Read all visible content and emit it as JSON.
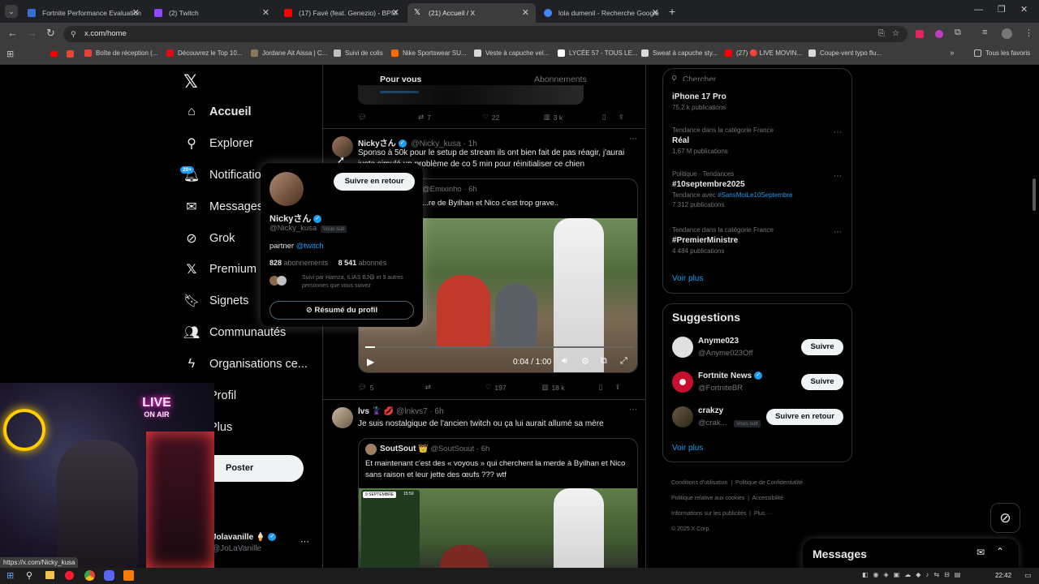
{
  "browser": {
    "tabs": [
      {
        "title": "Fortnite Performance Evaluation",
        "favicon_color": "#3a6fd8"
      },
      {
        "title": "(2) Twitch",
        "favicon_color": "#9146ff"
      },
      {
        "title": "(17) Favé (feat. Genezio) - BPM",
        "favicon_color": "#ff0000"
      },
      {
        "title": "(21) Accueil / X",
        "favicon_color": "#ffffff"
      },
      {
        "title": "lola dumenil - Recherche Google",
        "favicon_color": "#4285f4"
      }
    ],
    "url": "x.com/home",
    "status_url": "https://x.com/Nicky_kusa",
    "bookmarks": [
      "Boîte de réception (...",
      "Découvrez le Top 10...",
      "Jordane Ait Aissa | C...",
      "Suivi de colis",
      "Nike Sportswear SU...",
      "Veste à capuche vel...",
      "LYCÉE 57 - TOUS LE...",
      "Sweat à capuche sty...",
      "(27) 🔴 LIVE MOVIN...",
      "Coupe-vent typo flu...",
      "Tous les favoris"
    ]
  },
  "nav": {
    "items": [
      {
        "label": "Accueil",
        "icon": "home-icon"
      },
      {
        "label": "Explorer",
        "icon": "search-icon"
      },
      {
        "label": "Notifications",
        "icon": "bell-icon",
        "badge": "20+"
      },
      {
        "label": "Messages",
        "icon": "mail-icon"
      },
      {
        "label": "Grok",
        "icon": "grok-icon"
      },
      {
        "label": "Premium",
        "icon": "x-icon"
      },
      {
        "label": "Signets",
        "icon": "bookmark-icon"
      },
      {
        "label": "Communautés",
        "icon": "people-icon"
      },
      {
        "label": "Organisations ce...",
        "icon": "lightning-icon"
      },
      {
        "label": "Profil",
        "icon": "user-icon"
      },
      {
        "label": "Plus",
        "icon": "more-icon"
      }
    ],
    "post_button": "Poster",
    "account": {
      "name": "Jolavanille 🍦",
      "handle": "@JoLaVanille"
    }
  },
  "feed": {
    "tabs": [
      "Pour vous",
      "Abonnements"
    ],
    "top_actions": {
      "replies": "",
      "reposts": "7",
      "likes": "22",
      "views": "3 k"
    },
    "tweets": [
      {
        "name": "Nickyさん",
        "handle": "@Nicky_kusa",
        "time": "1h",
        "text": "Sponso à 50k pour le setup de stream ils ont bien fait de pas réagir, j'aurai juste simulé un problème de co 5 min pour réinitialiser ce chien",
        "quote_author": "@Emixinho · 6h",
        "quote_text": "...re de Byilhan et Nico c'est trop grave..",
        "video_time": "0:04 / 1:00",
        "replies": "5",
        "reposts": "",
        "likes": "197",
        "views": "18 k"
      },
      {
        "name": "lvs 🦹 💋",
        "handle": "@lnkvs7",
        "time": "6h",
        "text": "Je suis nostalgique de l'ancien twitch ou ça lui aurait allumé sa mère",
        "quote_name": "SoutSout 👑",
        "quote_handle": "@SoutSouut · 6h",
        "quote_text": "Et maintenant c'est des « voyous » qui cherchent la merde à Byilhan et Nico sans raison et leur jette des œufs ??? wtf",
        "media_date": "9 SEPTEMBRE",
        "media_time": "15:50"
      }
    ]
  },
  "hovercard": {
    "name": "Nickyさん",
    "handle": "@Nicky_kusa",
    "follows_you": "Vous suit",
    "follow_back": "Suivre en retour",
    "bio_prefix": "partner",
    "bio_link": "@twitch",
    "following_count": "828",
    "following_label": "abonnements",
    "followers_count": "8 541",
    "followers_label": "abonnés",
    "followed_by": "Suivi par Hamza, ILIAS BJ😷 et 9 autres personnes que vous suivez",
    "summary_button": "Résumé du profil"
  },
  "sidebar": {
    "search_placeholder": "Chercher",
    "trends": [
      {
        "category": "",
        "title": "iPhone 17 Pro",
        "meta": "75,2 k publications"
      },
      {
        "category": "Tendance dans la catégorie France",
        "title": "Réal",
        "meta": "1,67 M publications"
      },
      {
        "category": "Politique · Tendances",
        "title": "#10septembre2025",
        "meta_prefix": "Tendance avec",
        "meta_link": "#SansMoiLe10Septembre",
        "meta": "7 312 publications"
      },
      {
        "category": "Tendance dans la catégorie France",
        "title": "#PremierMinistre",
        "meta": "4 484 publications"
      }
    ],
    "show_more": "Voir plus",
    "suggestions_title": "Suggestions",
    "suggestions": [
      {
        "name": "Anyme023",
        "handle": "@Anyme023Off",
        "button": "Suivre",
        "verified": false
      },
      {
        "name": "Fortnite News",
        "handle": "@FortniteBR",
        "button": "Suivre",
        "verified": true
      },
      {
        "name": "crakzy",
        "handle": "@crak...",
        "tag": "Vous suit",
        "button": "Suivre en retour",
        "verified": false
      }
    ],
    "suggestions_more": "Voir plus",
    "footer": [
      "Conditions d'utilisation",
      "Politique de Confidentialité",
      "Politique relative aux cookies",
      "Accessibilité",
      "Informations sur les publicités",
      "Plus ···",
      "© 2025 X Corp."
    ],
    "messages_label": "Messages"
  },
  "webcam": {
    "neon_text_1": "LIVE",
    "neon_text_2": "ON AIR"
  },
  "taskbar": {
    "clock": "22:42"
  },
  "colors": {
    "accent": "#1d9bf0",
    "bg": "#000000",
    "border": "#2f3336",
    "muted": "#71767b"
  }
}
